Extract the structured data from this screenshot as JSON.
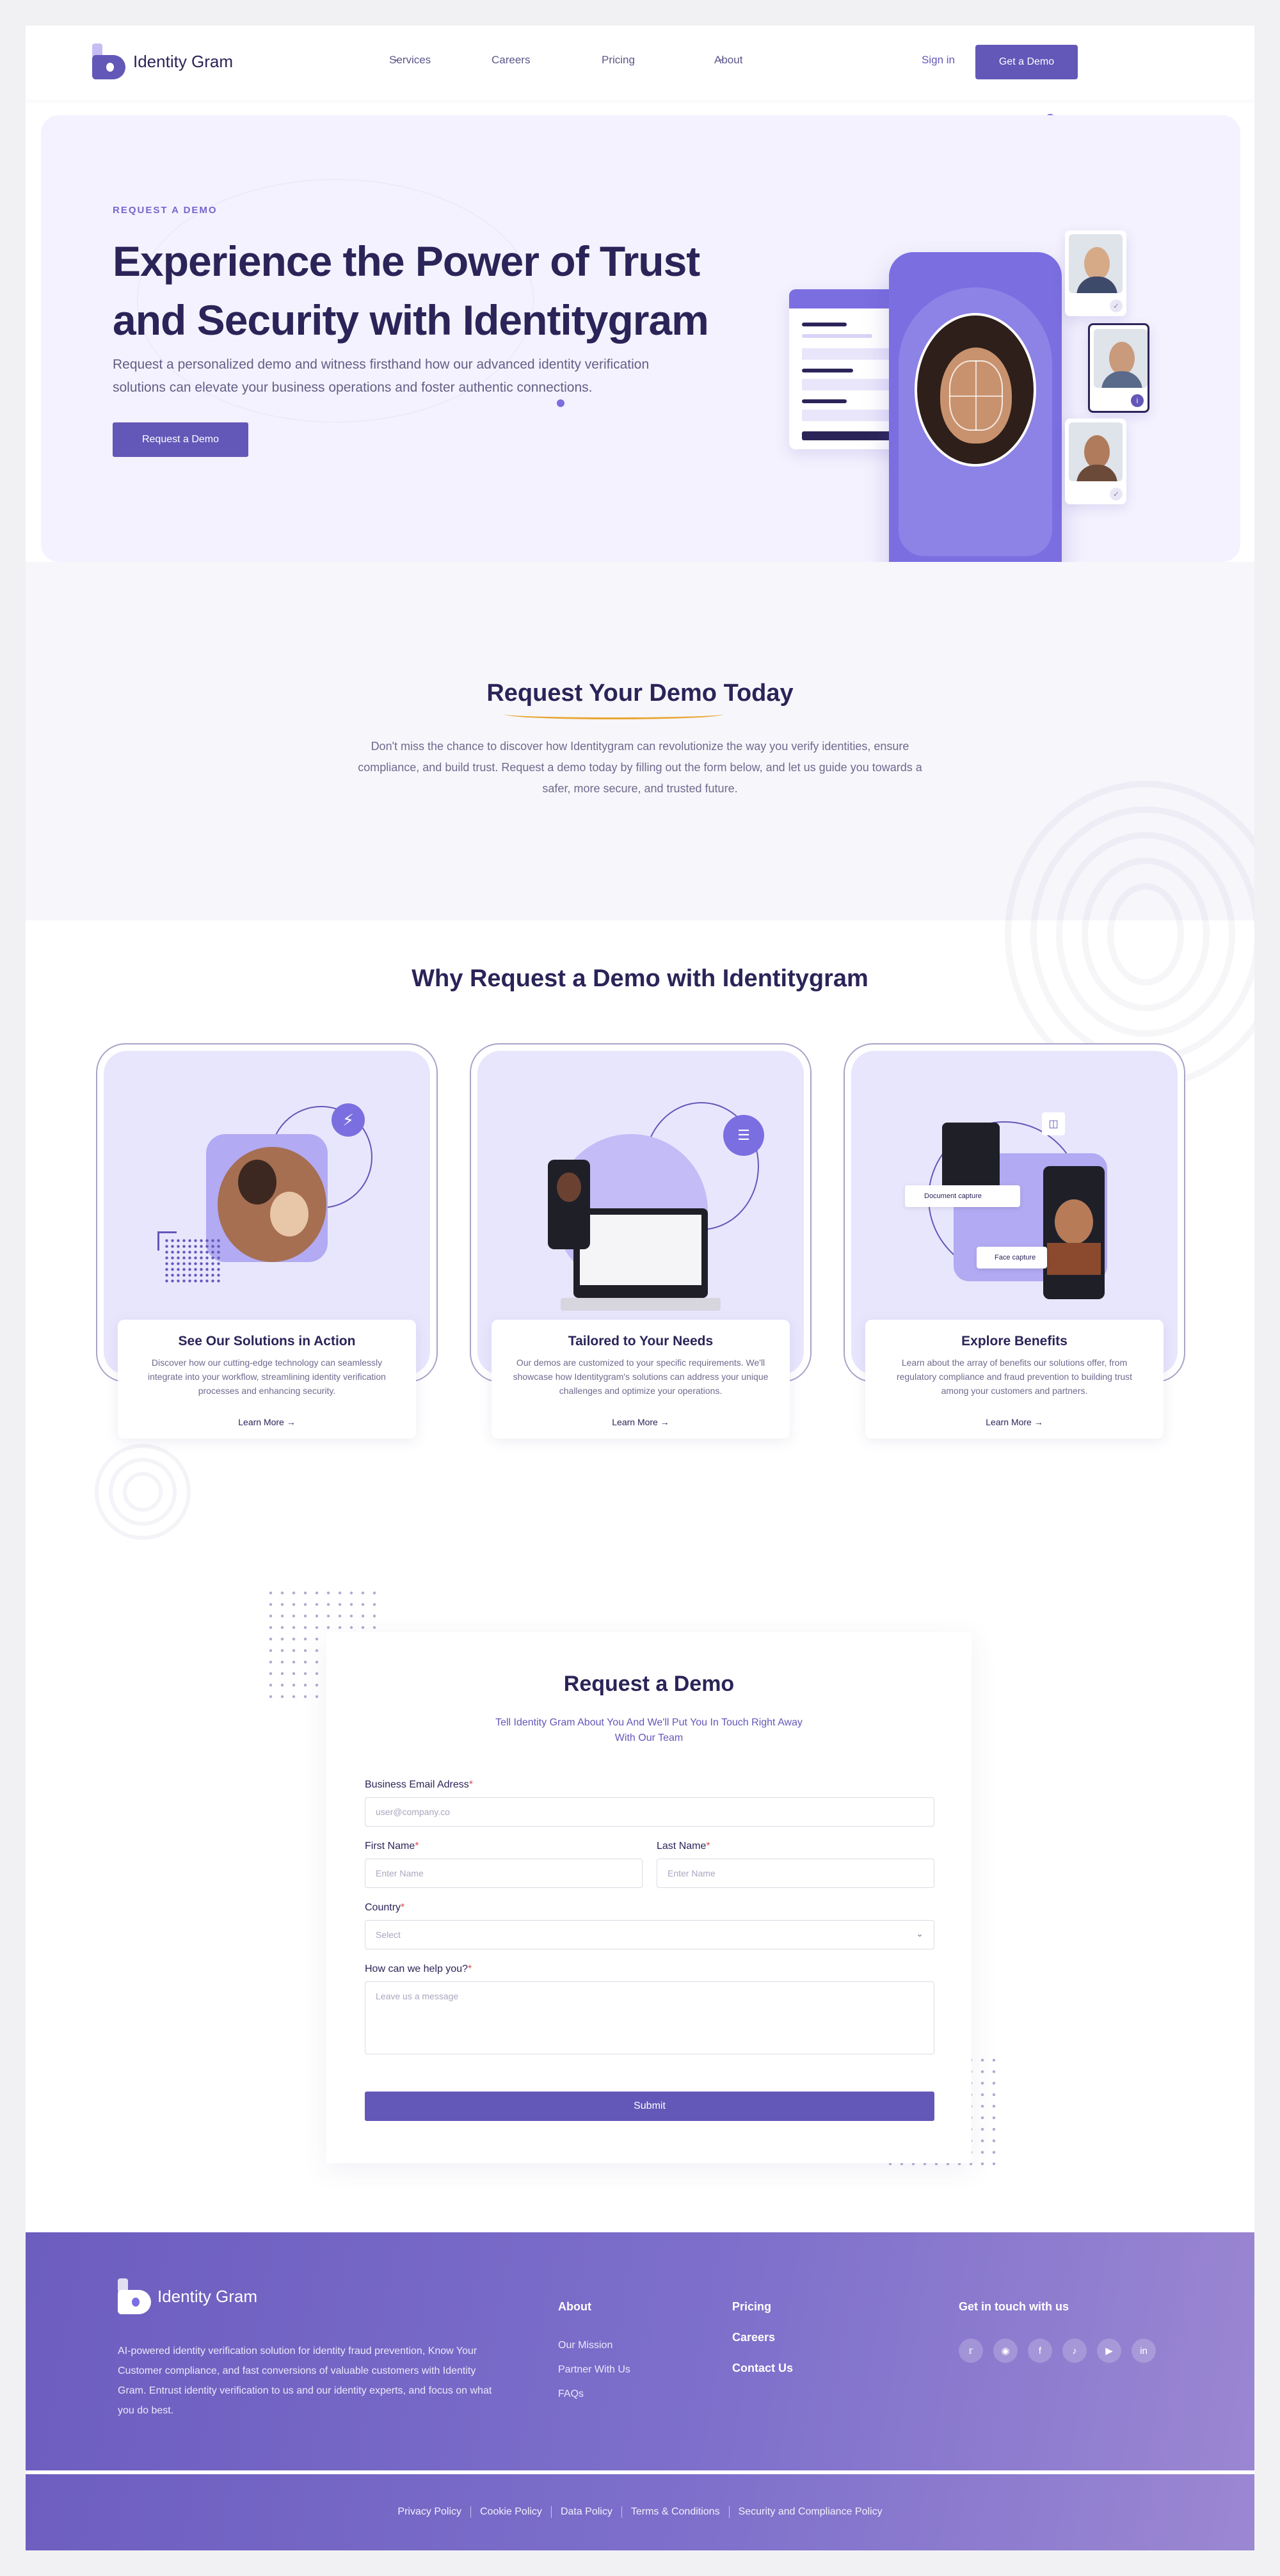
{
  "brand": {
    "name": "Identity Gram",
    "accent": "#6357b8",
    "accent_light": "#7b6ee0",
    "hero_bg": "#f4f2fe",
    "dark_text": "#2a2458"
  },
  "nav": {
    "items": [
      {
        "label": "Services",
        "has_dropdown": true
      },
      {
        "label": "Careers",
        "has_dropdown": false
      },
      {
        "label": "Pricing",
        "has_dropdown": false
      },
      {
        "label": "About",
        "has_dropdown": true
      }
    ],
    "sign_in": "Sign in",
    "cta": "Get a Demo"
  },
  "hero": {
    "eyebrow": "REQUEST A DEMO",
    "title": "Experience the Power of Trust and Security with Identitygram",
    "description": "Request a personalized demo and witness firsthand how our advanced identity verification solutions can elevate your business operations and foster authentic connections.",
    "button": "Request a Demo"
  },
  "request_section": {
    "title": "Request Your Demo Today",
    "description": "Don't miss the chance to discover how Identitygram can revolutionize the way you verify identities, ensure compliance, and build trust. Request a demo today by filling out the form below, and let us guide you towards a safer, more secure, and trusted future."
  },
  "why": {
    "title": "Why Request a Demo with Identitygram",
    "cards": [
      {
        "title": "See Our Solutions in Action",
        "text": "Discover how our cutting-edge technology can seamlessly integrate into your workflow, streamlining identity verification processes and enhancing security.",
        "link": "Learn More"
      },
      {
        "title": "Tailored to Your Needs",
        "text": "Our demos are customized to your specific requirements. We'll showcase how Identitygram's solutions can address your unique challenges and optimize your operations.",
        "link": "Learn More"
      },
      {
        "title": "Explore Benefits",
        "text": "Learn about the array of benefits our solutions offer, from regulatory compliance and fraud prevention to building trust among your customers and partners.",
        "link": "Learn More"
      }
    ],
    "card3_labels": {
      "doc": "Document capture",
      "face": "Face capture"
    }
  },
  "form": {
    "title": "Request a Demo",
    "subtitle": "Tell Identity Gram About You And We'll Put You In Touch Right Away With Our Team",
    "email_label": "Business Email Adress",
    "email_placeholder": "user@company.co",
    "first_label": "First Name",
    "first_placeholder": "Enter Name",
    "last_label": "Last Name",
    "last_placeholder": "Enter Name",
    "country_label": "Country",
    "country_value": "Select",
    "help_label": "How can we help you?",
    "help_placeholder": "Leave us a message",
    "required_mark": "*",
    "submit": "Submit"
  },
  "footer": {
    "brand": "Identity Gram",
    "description": "AI-powered identity verification solution for identity fraud prevention, Know Your Customer compliance, and fast conversions of valuable customers with Identity Gram. Entrust identity verification to us and our identity experts, and focus on what you do best.",
    "about_heading": "About",
    "about_links": [
      "Our Mission",
      "Partner With Us",
      "FAQs"
    ],
    "col2_links": [
      "Pricing",
      "Careers",
      "Contact Us"
    ],
    "contact_heading": "Get in touch with us",
    "socials": [
      "twitter-icon",
      "instagram-icon",
      "facebook-icon",
      "tiktok-icon",
      "youtube-icon",
      "linkedin-icon"
    ],
    "legal": [
      "Privacy Policy",
      "Cookie Policy",
      "Data Policy",
      "Terms & Conditions",
      "Security and Compliance Policy"
    ]
  }
}
